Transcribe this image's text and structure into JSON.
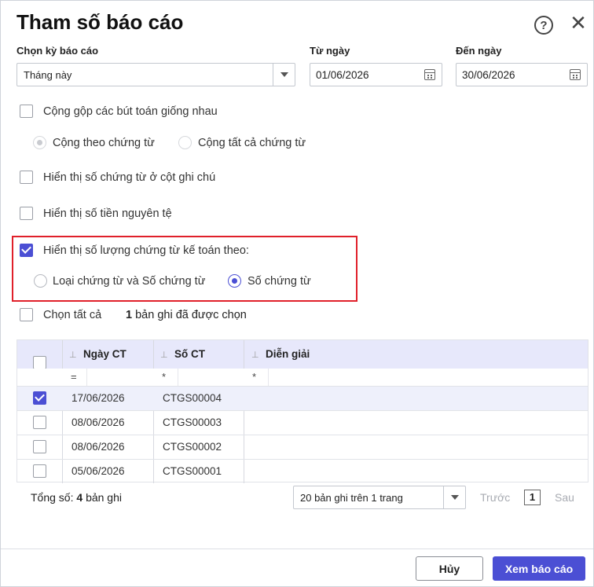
{
  "dialog": {
    "title": "Tham số báo cáo"
  },
  "period": {
    "label": "Chọn kỳ báo cáo",
    "value": "Tháng này"
  },
  "from_date": {
    "label": "Từ ngày",
    "value": "01/06/2026"
  },
  "to_date": {
    "label": "Đến ngày",
    "value": "30/06/2026"
  },
  "options": {
    "merge_entries": {
      "label": "Cộng gộp các bút toán giống nhau",
      "checked": false
    },
    "merge_mode": {
      "by_voucher": "Cộng theo chứng từ",
      "all_vouchers": "Cộng tất cả chứng từ"
    },
    "show_voucher_in_note": {
      "label": "Hiển thị số chứng từ ở cột ghi chú",
      "checked": false
    },
    "show_foreign_amount": {
      "label": "Hiển thị số tiền nguyên tệ",
      "checked": false
    },
    "show_voucher_count": {
      "label": "Hiển thị số lượng chứng từ kế toán theo:",
      "checked": true
    },
    "count_mode": {
      "type_and_number": "Loại chứng từ và Số chứng từ",
      "number_only": "Số chứng từ"
    }
  },
  "selection": {
    "select_all": "Chọn tất cả",
    "selected_count": "1",
    "selected_suffix": "bản ghi đã được chọn"
  },
  "grid": {
    "columns": [
      "Ngày CT",
      "Số CT",
      "Diễn giải"
    ],
    "filters": [
      "=",
      "*",
      "*"
    ],
    "rows": [
      {
        "date": "17/06/2026",
        "number": "CTGS00004",
        "desc": "",
        "checked": true
      },
      {
        "date": "08/06/2026",
        "number": "CTGS00003",
        "desc": "",
        "checked": false
      },
      {
        "date": "08/06/2026",
        "number": "CTGS00002",
        "desc": "",
        "checked": false
      },
      {
        "date": "05/06/2026",
        "number": "CTGS00001",
        "desc": "",
        "checked": false
      }
    ]
  },
  "footer": {
    "total_prefix": "Tổng số:",
    "total_count": "4",
    "total_suffix": "bản ghi",
    "page_size": "20 bản ghi trên 1 trang",
    "prev": "Trước",
    "page": "1",
    "next": "Sau"
  },
  "buttons": {
    "cancel": "Hủy",
    "view": "Xem báo cáo"
  },
  "colors": {
    "accent": "#4b4fd4",
    "highlight": "#e0202a",
    "grid_header": "#e7e8fb"
  }
}
